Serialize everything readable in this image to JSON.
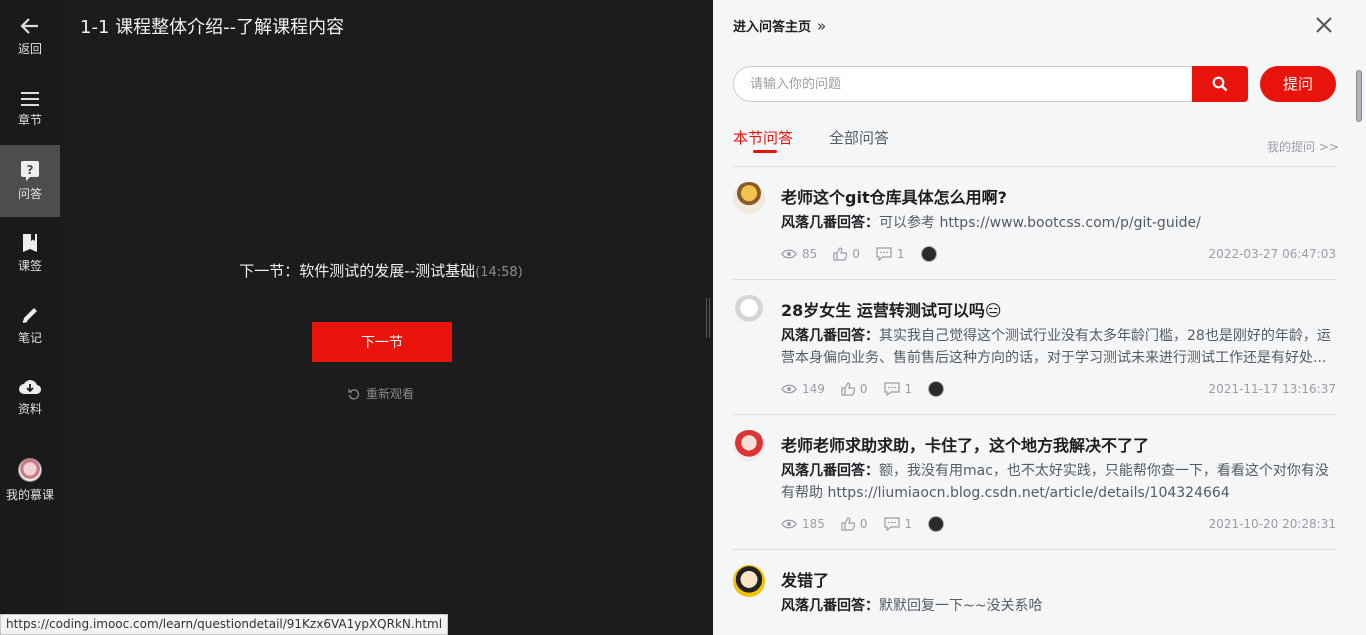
{
  "nav": {
    "back": "返回",
    "chapters": "章节",
    "qa": "问答",
    "bookmarks": "课签",
    "notes": "笔记",
    "materials": "资料",
    "my_course": "我的慕课"
  },
  "player": {
    "title": "1-1 课程整体介绍--了解课程内容",
    "next_text": "下一节：软件测试的发展--测试基础",
    "next_duration": "(14:58)",
    "next_button": "下一节",
    "rewatch": "重新观看"
  },
  "statusbar": {
    "url": "https://coding.imooc.com/learn/questiondetail/91Kzx6VA1ypXQRkN.html"
  },
  "qa": {
    "enter_home": "进入问答主页",
    "search_placeholder": "请输入你的问题",
    "ask_button": "提问",
    "tab_section": "本节问答",
    "tab_all": "全部问答",
    "my_questions": "我的提问 >>",
    "items": [
      {
        "title": "老师这个git仓库具体怎么用啊?",
        "answerer": "风落几番回答：",
        "answer": "可以参考 https://www.bootcss.com/p/git-guide/",
        "views": "85",
        "likes": "0",
        "comments": "1",
        "time": "2022-03-27 06:47:03"
      },
      {
        "title": "28岁女生 运营转测试可以吗😑",
        "answerer": "风落几番回答：",
        "answer": "其实我自己觉得这个测试行业没有太多年龄门槛，28也是刚好的年龄，运营本身偏向业务、售前售后这种方向的话，对于学习测试未来进行测试工作还是有好处...",
        "views": "149",
        "likes": "0",
        "comments": "1",
        "time": "2021-11-17 13:16:37"
      },
      {
        "title": "老师老师求助求助，卡住了，这个地方我解决不了了",
        "answerer": "风落几番回答：",
        "answer": "额，我没有用mac，也不太好实践，只能帮你查一下，看看这个对你有没有帮助 https://liumiaocn.blog.csdn.net/article/details/104324664",
        "views": "185",
        "likes": "0",
        "comments": "1",
        "time": "2021-10-20 20:28:31"
      },
      {
        "title": "发错了",
        "answerer": "风落几番回答：",
        "answer": "默默回复一下~~没关系哈",
        "views": "",
        "likes": "",
        "comments": "",
        "time": ""
      }
    ]
  }
}
